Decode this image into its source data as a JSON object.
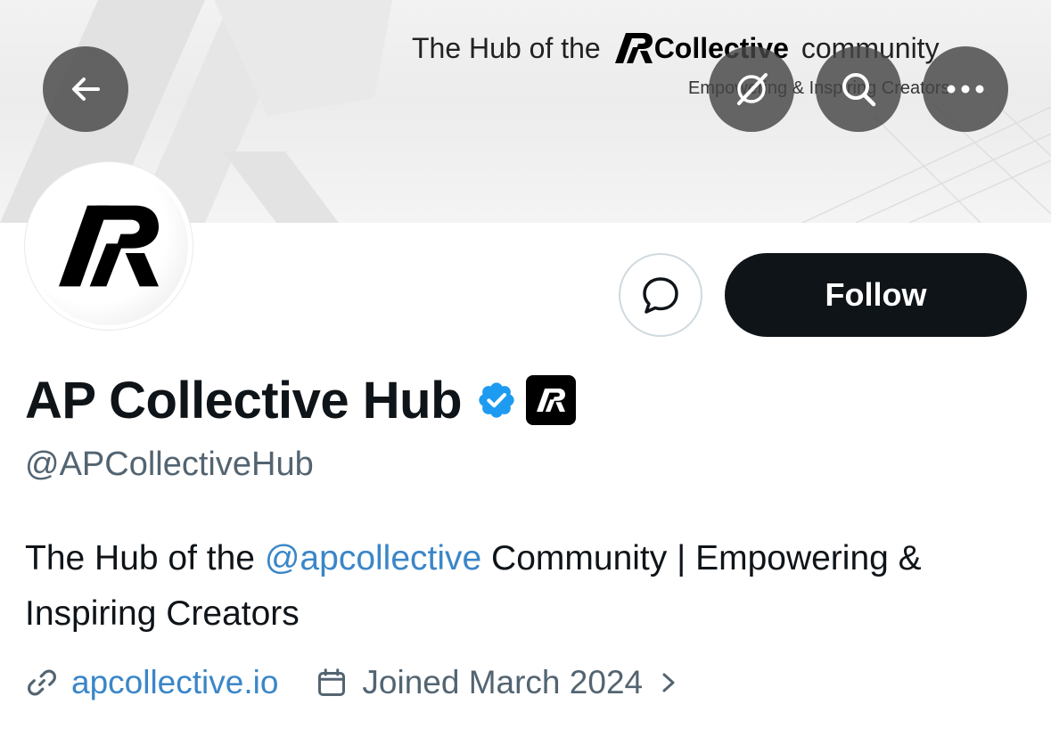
{
  "banner": {
    "title_prefix": "The Hub of the",
    "brand_name": "Collective",
    "title_suffix": "community",
    "subtitle": "Empowering & Inspiring Creators"
  },
  "header_buttons": {
    "back_icon": "arrow-left-icon",
    "grok_icon": "grok-icon",
    "search_icon": "search-icon",
    "more_icon": "more-horizontal-icon"
  },
  "profile": {
    "display_name": "AP Collective Hub",
    "handle": "@APCollectiveHub",
    "verified_color": "#1d9bf0",
    "bio_prefix": "The Hub of the ",
    "bio_mention": "@apcollective",
    "bio_suffix": " Community | Empowering & Inspiring Creators",
    "website": "apcollective.io",
    "joined": "Joined March 2024"
  },
  "actions": {
    "message_icon": "message-bubble-icon",
    "follow_label": "Follow"
  },
  "colors": {
    "accent_link": "#3a86c8",
    "follow_bg": "#0f1419",
    "secondary_text": "#536471"
  }
}
